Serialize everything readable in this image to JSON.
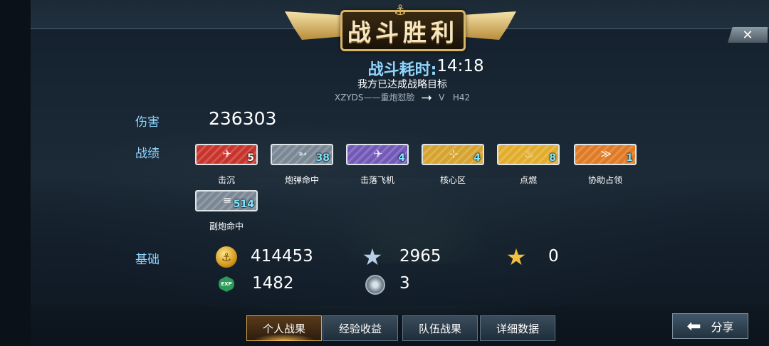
{
  "banner": {
    "title": "战斗胜利",
    "anchor_icon": "anchor-icon"
  },
  "close": {
    "icon": "close-icon",
    "label": "✕"
  },
  "summary": {
    "duration_label": "战斗耗时: ",
    "duration_value": "14:18",
    "goal_text": "我方已达成战略目标",
    "player_left": "XZYDS——重炮怼脸",
    "vs_text": "V",
    "player_right": "H42"
  },
  "damage": {
    "label": "伤害",
    "value": "236303"
  },
  "achievements": {
    "label": "战绩",
    "items": [
      {
        "icon": "sink-ship-icon",
        "count": "5",
        "caption": "击沉",
        "color": "#c8332b"
      },
      {
        "icon": "shell-hit-icon",
        "count": "38",
        "caption": "炮弹命中",
        "color": "#7a8794"
      },
      {
        "icon": "shoot-down-plane-icon",
        "count": "4",
        "caption": "击落飞机",
        "color": "#7258b8"
      },
      {
        "icon": "core-zone-icon",
        "count": "4",
        "caption": "核心区",
        "color": "#d7a32e"
      },
      {
        "icon": "ignite-icon",
        "count": "8",
        "caption": "点燃",
        "color": "#e3ad2c"
      },
      {
        "icon": "assist-capture-icon",
        "count": "1",
        "caption": "协助占领",
        "color": "#e07a25"
      },
      {
        "icon": "secondary-gun-hit-icon",
        "count": "514",
        "caption": "副炮命中",
        "color": "#7a8794"
      }
    ]
  },
  "basics": {
    "label": "基础",
    "coins": "414453",
    "blue_star": "2965",
    "gold_star": "0",
    "exp": "1482",
    "exp_icon_text": "EXP",
    "parts": "3"
  },
  "tabs": [
    {
      "label": "个人战果",
      "active": true
    },
    {
      "label": "经验收益",
      "active": false
    },
    {
      "label": "队伍战果",
      "active": false
    },
    {
      "label": "详细数据",
      "active": false
    }
  ],
  "share": {
    "label": "分享",
    "icon": "back-arrow-icon"
  }
}
